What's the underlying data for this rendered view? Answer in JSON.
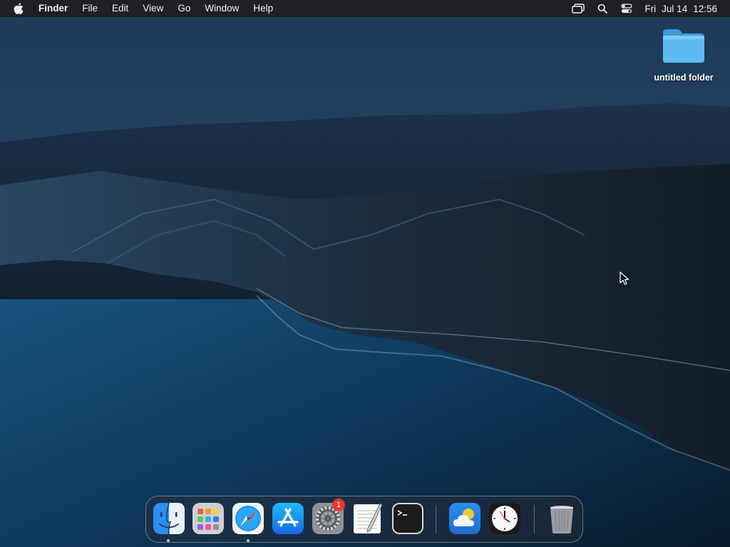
{
  "menubar": {
    "app_name": "Finder",
    "menus": [
      "File",
      "Edit",
      "View",
      "Go",
      "Window",
      "Help"
    ],
    "clock": {
      "day": "Fri",
      "date": "Jul 14",
      "time": "12:56"
    }
  },
  "desktop": {
    "folder": {
      "label": "untitled folder",
      "icon": "folder-icon"
    }
  },
  "dock": {
    "items": [
      {
        "name": "Finder",
        "icon": "finder-icon",
        "running": true
      },
      {
        "name": "Launchpad",
        "icon": "launchpad-icon",
        "running": false
      },
      {
        "name": "Safari",
        "icon": "safari-icon",
        "running": true
      },
      {
        "name": "App Store",
        "icon": "app-store-icon",
        "running": false
      },
      {
        "name": "System Preferences",
        "icon": "system-preferences-icon",
        "running": false,
        "badge": "1"
      },
      {
        "name": "TextEdit",
        "icon": "textedit-icon",
        "running": false
      },
      {
        "name": "Terminal",
        "icon": "terminal-icon",
        "running": false
      },
      {
        "name": "Weather",
        "icon": "weather-icon",
        "running": false
      },
      {
        "name": "Clock",
        "icon": "clock-icon",
        "running": false
      },
      {
        "name": "Trash",
        "icon": "trash-icon",
        "running": false
      }
    ]
  },
  "colors": {
    "menubar_bg": "#1e1e1e",
    "folder_blue": "#4fb3ef",
    "badge_red": "#e8392f",
    "wallpaper_sky": "#1b3552",
    "wallpaper_sea": "#0f3d63"
  }
}
